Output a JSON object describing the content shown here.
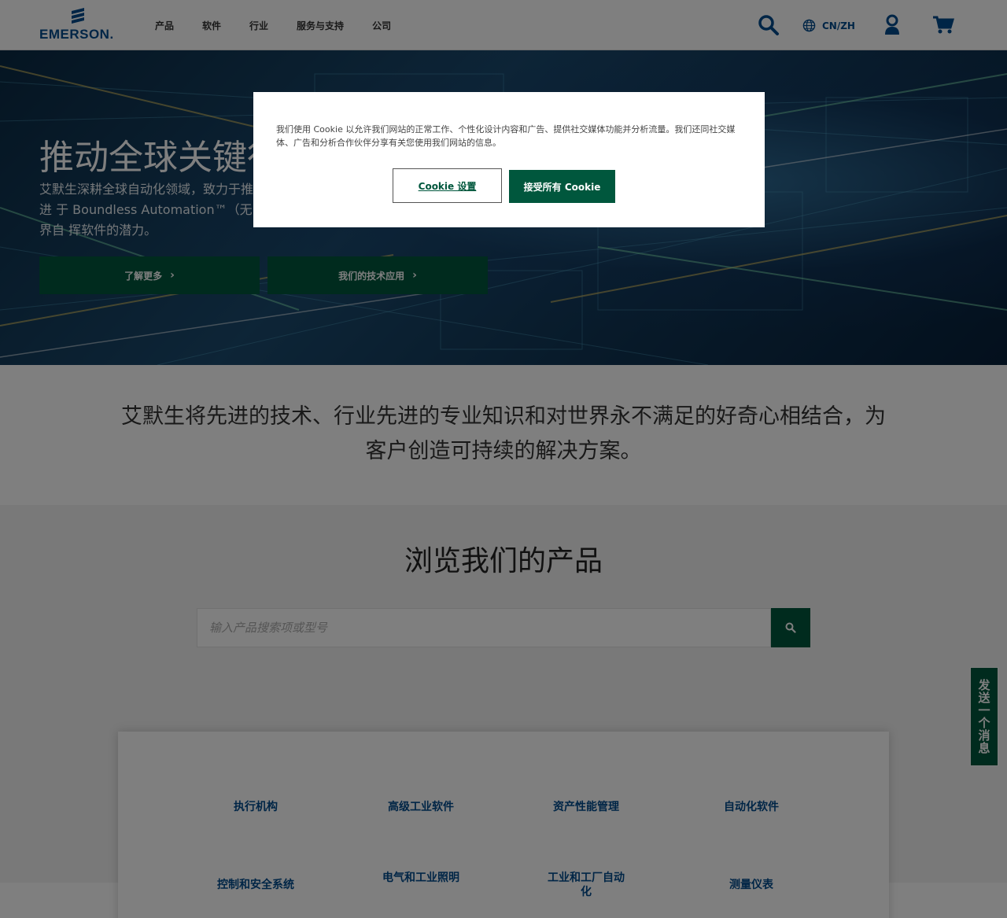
{
  "header": {
    "logo_text": "EMERSON.",
    "nav": [
      "产品",
      "软件",
      "行业",
      "服务与支持",
      "公司"
    ],
    "lang": "CN/ZH",
    "icons": [
      "search-icon",
      "globe-icon",
      "user-icon",
      "cart-icon"
    ]
  },
  "hero": {
    "title": "推动全球关键行业",
    "description": "艾默生深耕全球自动化领域，致力于推进 于 Boundless Automation™（无界自 挥软件的潜力。",
    "buttons": [
      "了解更多",
      "我们的技术应用"
    ]
  },
  "intro": {
    "text": "艾默生将先进的技术、行业先进的专业知识和对世界永不满足的好奇心相结合，为客户创造可持续的解决方案。"
  },
  "browse": {
    "title": "浏览我们的产品",
    "search_placeholder": "输入产品搜索项或型号"
  },
  "products": [
    "执行机构",
    "高级工业软件",
    "资产性能管理",
    "自动化软件",
    "控制和安全系统",
    "电气和工业照明",
    "工业和工厂自动化",
    "测量仪表"
  ],
  "feedback": "发送一个消息",
  "cookie": {
    "text": "我们使用 Cookie 以允许我们网站的正常工作、个性化设计内容和广告、提供社交媒体功能并分析流量。我们还同社交媒体、广告和分析合作伙伴分享有关您使用我们网站的信息。",
    "settings_label": "Cookie 设置",
    "accept_label": "接受所有 Cookie"
  },
  "colors": {
    "brand_green": "#00573d",
    "brand_blue": "#004b8d"
  }
}
